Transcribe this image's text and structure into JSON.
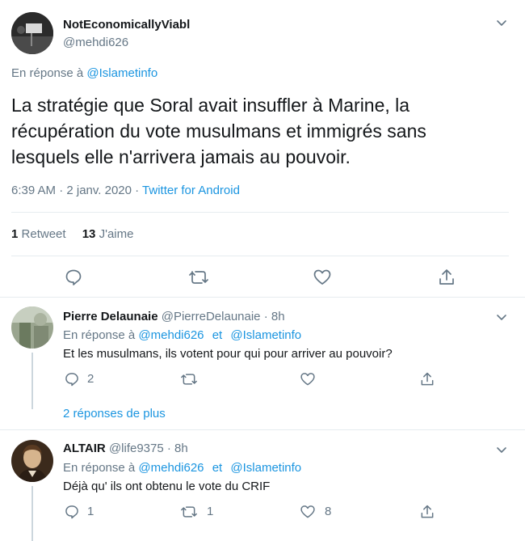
{
  "main_tweet": {
    "display_name": "NotEconomicallyViabl",
    "handle": "@mehdi626",
    "reply_prefix": "En réponse à",
    "reply_to": "@Islametinfo",
    "text": "La stratégie que Soral avait insuffler à Marine, la récupération du vote musulmans et immigrés sans lesquels elle n'arrivera jamais au pouvoir.",
    "timestamp": "6:39 AM · 2 janv. 2020",
    "separator": " · ",
    "client": "Twitter for Android",
    "retweet_count": "1",
    "retweet_label": "Retweet",
    "like_count": "13",
    "like_label": "J'aime"
  },
  "replies": [
    {
      "display_name": "Pierre Delaunaie",
      "handle": "@PierreDelaunaie",
      "time": "· 8h",
      "reply_prefix": "En réponse à",
      "reply_to_1": "@mehdi626",
      "conj": "et",
      "reply_to_2": "@Islametinfo",
      "text": "Et les musulmans, ils votent pour qui pour arriver au pouvoir?",
      "reply_count": "2",
      "retweet_count": "",
      "like_count": "",
      "more_replies": "2 réponses de plus"
    },
    {
      "display_name": "ALTAIR",
      "handle": "@life9375",
      "time": "· 8h",
      "reply_prefix": "En réponse à",
      "reply_to_1": "@mehdi626",
      "conj": "et",
      "reply_to_2": "@Islametinfo",
      "text": "Déjà qu' ils ont obtenu le vote du CRIF",
      "reply_count": "1",
      "retweet_count": "1",
      "like_count": "8"
    }
  ],
  "icons": {
    "reply": "reply-icon",
    "retweet": "retweet-icon",
    "like": "heart-icon",
    "share": "share-icon",
    "more": "chevron-down-icon"
  },
  "colors": {
    "link": "#1b95e0",
    "muted": "#657786",
    "divider": "#e6ecf0"
  }
}
